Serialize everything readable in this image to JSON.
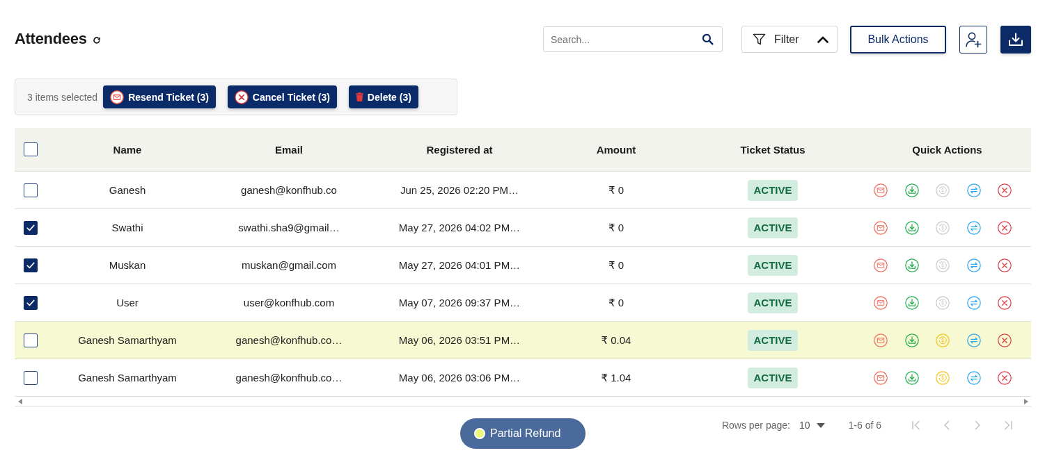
{
  "header": {
    "title": "Attendees"
  },
  "toolbar": {
    "search": {
      "placeholder": "Search..."
    },
    "filter": {
      "label": "Filter",
      "expanded": true
    },
    "bulk_actions": {
      "label": "Bulk Actions"
    }
  },
  "selection_bar": {
    "count_text": "3 items selected",
    "actions": [
      {
        "kind": "resend",
        "label": "Resend Ticket (3)"
      },
      {
        "kind": "cancel",
        "label": "Cancel Ticket (3)"
      },
      {
        "kind": "delete",
        "label": "Delete (3)"
      }
    ]
  },
  "table": {
    "select_all_checked": false,
    "columns": [
      "Name",
      "Email",
      "Registered at",
      "Amount",
      "Ticket Status",
      "Quick Actions"
    ],
    "rows": [
      {
        "selected": false,
        "highlighted": false,
        "name": "Ganesh",
        "email": "ganesh@konfhub.co",
        "registered_at": "Jun 25, 2026 02:20 PM…",
        "amount": "₹ 0",
        "status": "ACTIVE",
        "refund_available": false
      },
      {
        "selected": true,
        "highlighted": false,
        "name": "Swathi",
        "email": "swathi.sha9@gmail…",
        "registered_at": "May 27, 2026 04:02 PM…",
        "amount": "₹ 0",
        "status": "ACTIVE",
        "refund_available": false
      },
      {
        "selected": true,
        "highlighted": false,
        "name": "Muskan",
        "email": "muskan@gmail.com",
        "registered_at": "May 27, 2026 04:01 PM…",
        "amount": "₹ 0",
        "status": "ACTIVE",
        "refund_available": false
      },
      {
        "selected": true,
        "highlighted": false,
        "name": "User",
        "email": "user@konfhub.com",
        "registered_at": "May 07, 2026 09:37 PM…",
        "amount": "₹ 0",
        "status": "ACTIVE",
        "refund_available": false
      },
      {
        "selected": false,
        "highlighted": true,
        "name": "Ganesh Samarthyam",
        "email": "ganesh@konfhub.co…",
        "registered_at": "May 06, 2026 03:51 PM…",
        "amount": "₹ 0.04",
        "status": "ACTIVE",
        "refund_available": true
      },
      {
        "selected": false,
        "highlighted": false,
        "name": "Ganesh Samarthyam",
        "email": "ganesh@konfhub.co…",
        "registered_at": "May 06, 2026 03:06 PM…",
        "amount": "₹ 1.04",
        "status": "ACTIVE",
        "refund_available": true
      }
    ]
  },
  "legend": {
    "label": "Partial Refund"
  },
  "pagination": {
    "rows_per_page_label": "Rows per page:",
    "rows_per_page": "10",
    "range": "1-6 of 6",
    "nav": [
      {
        "kind": "first",
        "disabled": true
      },
      {
        "kind": "prev",
        "disabled": true
      },
      {
        "kind": "next",
        "disabled": true
      },
      {
        "kind": "last",
        "disabled": true
      }
    ]
  }
}
